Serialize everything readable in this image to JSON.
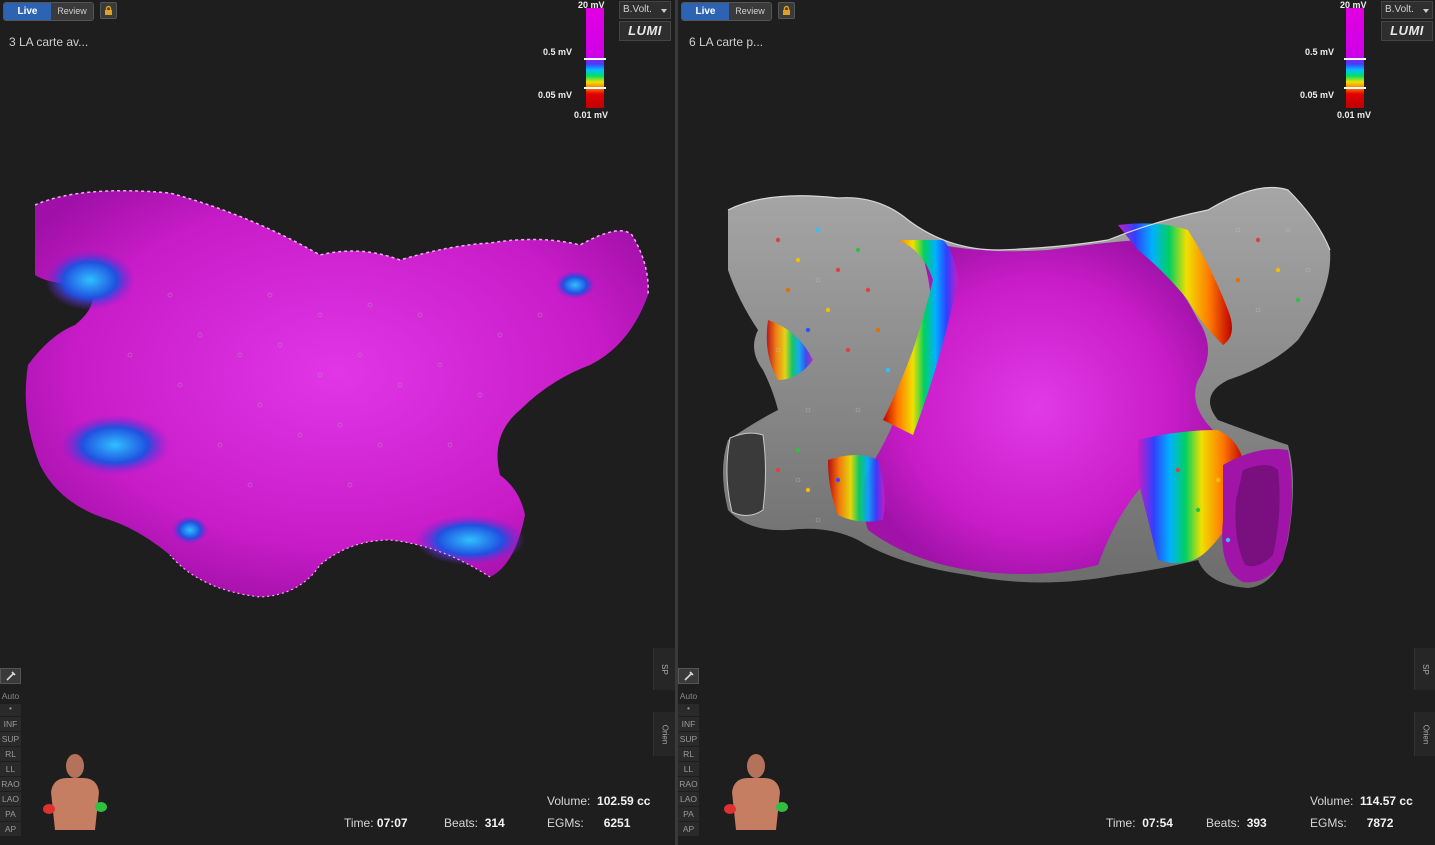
{
  "left": {
    "mode": {
      "live_label": "Live",
      "review_label": "Review"
    },
    "map_title": "3 LA carte av...",
    "scale": {
      "top_label": "20 mV",
      "mid_label": "0.5 mV",
      "low_label": "0.05 mV",
      "bottom_label": "0.01 mV"
    },
    "param_select": "B.Volt.",
    "logo": "LUMI",
    "side_tabs": [
      "SP",
      "Orien"
    ],
    "view_buttons": {
      "auto_label": "Auto",
      "dot_label": "•",
      "views": [
        "INF",
        "SUP",
        "RL",
        "LL",
        "RAO",
        "LAO",
        "PA",
        "AP"
      ]
    },
    "stats": {
      "volume_label": "Volume:",
      "volume_value": "102.59 cc",
      "time_label": "Time:",
      "time_value": "07:07",
      "beats_label": "Beats:",
      "beats_value": "314",
      "egms_label": "EGMs:",
      "egms_value": "6251"
    }
  },
  "right": {
    "mode": {
      "live_label": "Live",
      "review_label": "Review"
    },
    "map_title": "6 LA carte p...",
    "scale": {
      "top_label": "20 mV",
      "mid_label": "0.5 mV",
      "low_label": "0.05 mV",
      "bottom_label": "0.01 mV"
    },
    "param_select": "B.Volt.",
    "logo": "LUMI",
    "side_tabs": [
      "SP",
      "Orien"
    ],
    "view_buttons": {
      "auto_label": "Auto",
      "dot_label": "•",
      "views": [
        "INF",
        "SUP",
        "RL",
        "LL",
        "RAO",
        "LAO",
        "PA",
        "AP"
      ]
    },
    "stats": {
      "volume_label": "Volume:",
      "volume_value": "114.57 cc",
      "time_label": "Time:",
      "time_value": "07:54",
      "beats_label": "Beats:",
      "beats_value": "393",
      "egms_label": "EGMs:",
      "egms_value": "7872"
    }
  },
  "colors": {
    "healthy": "#d21ed2",
    "scar": "#8a8a8a",
    "live_button": "#2c63b3",
    "background": "#1e1e1e"
  }
}
